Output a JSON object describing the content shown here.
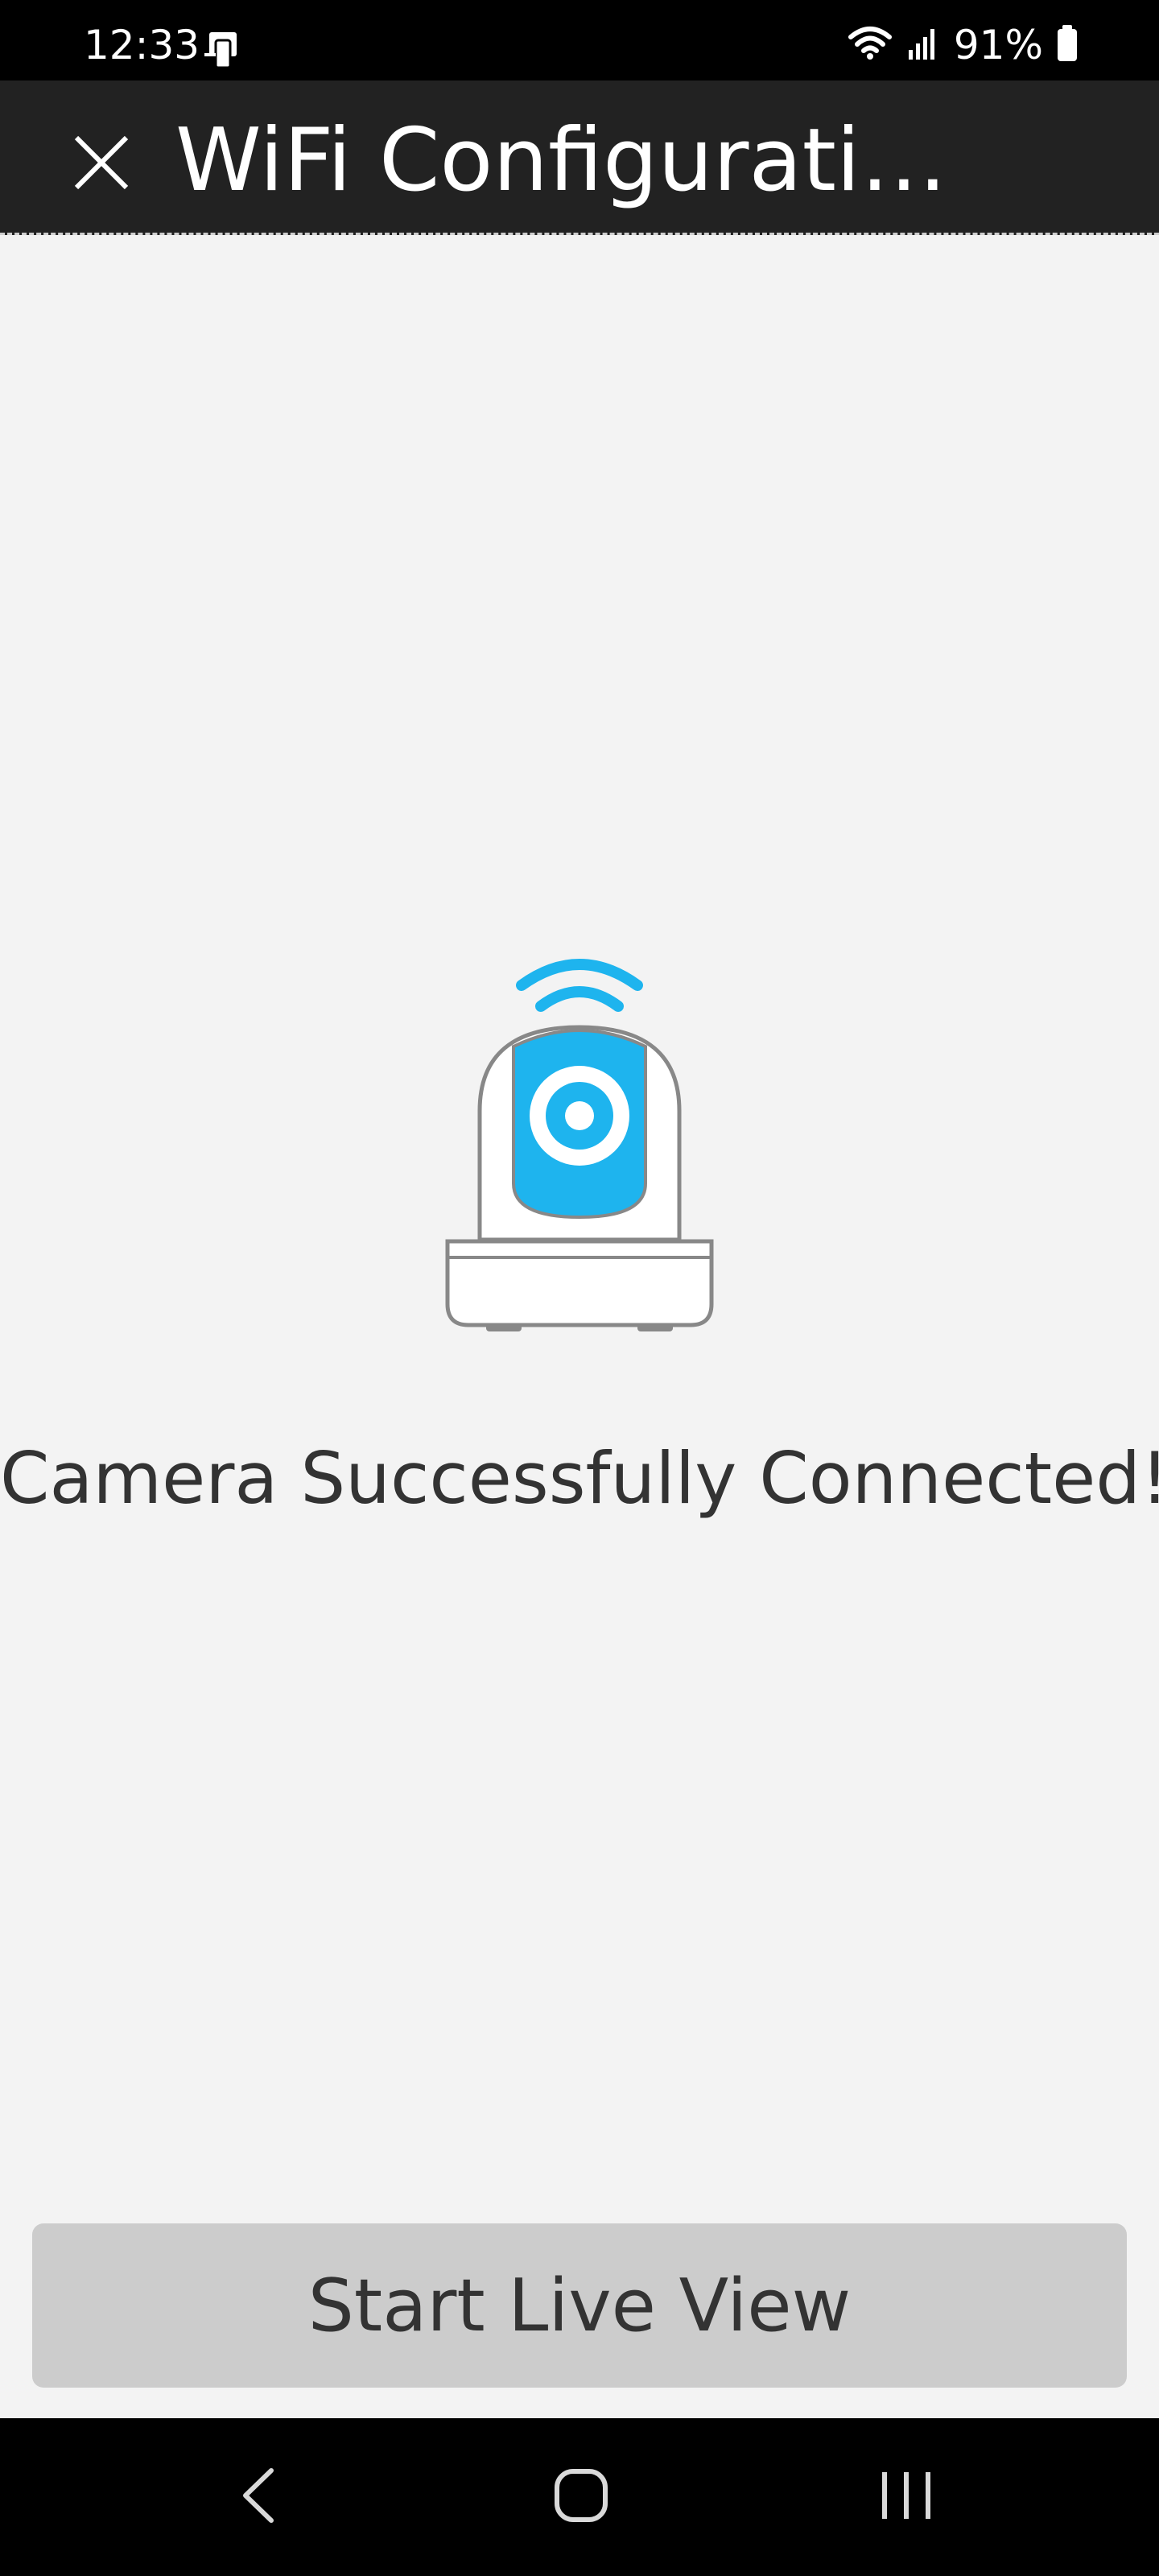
{
  "status_bar": {
    "time": "12:33",
    "battery": "91%",
    "icons": [
      "device-notification-icon",
      "wifi-icon",
      "signal-icon",
      "battery-icon"
    ]
  },
  "app_bar": {
    "title": "WiFi Configuration...",
    "close_icon": "close-icon"
  },
  "main": {
    "illustration": "camera-icon",
    "message": "Camera Successfully Connected!",
    "primary_button": "Start Live View"
  },
  "nav_bar": {
    "buttons": [
      "back-icon",
      "home-icon",
      "recents-icon"
    ]
  },
  "colors": {
    "accent": "#1eb4ee",
    "app_bar_bg": "#222222",
    "page_bg": "#f3f3f3",
    "button_bg": "#cccccc"
  }
}
